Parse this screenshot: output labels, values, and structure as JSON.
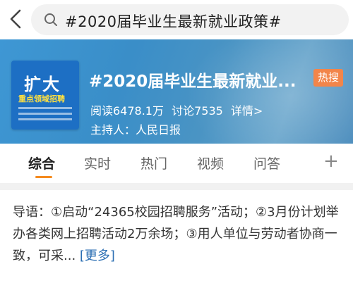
{
  "search": {
    "query": "#2020届毕业生最新就业政策#"
  },
  "topic": {
    "title": "#2020届毕业生最新就业政策#",
    "hot_badge": "热搜",
    "reads": "阅读6478.1万",
    "discussions": "讨论7535",
    "details": "详情>",
    "host": "主持人：人民日报",
    "logo_big": "扩大",
    "logo_small": "重点领域招聘"
  },
  "tabs": [
    {
      "label": "综合"
    },
    {
      "label": "实时"
    },
    {
      "label": "热门"
    },
    {
      "label": "视频"
    },
    {
      "label": "问答"
    }
  ],
  "tab_add": "+",
  "summary": {
    "text": "导语：①启动“24365校园招聘服务”活动；②3月份计划举办各类网上招聘活动2万余场；③用人单位与劳动者协商一致，可采...",
    "more": "[更多]"
  },
  "colors": {
    "accent": "#f58b1f",
    "banner": "#3e97d4",
    "hot": "#f2854a",
    "link": "#2c6fb3"
  }
}
